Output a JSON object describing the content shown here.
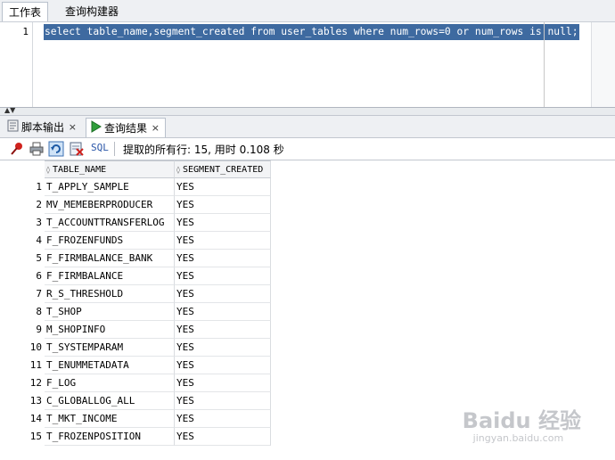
{
  "editor_tabs": [
    "工作表",
    "查询构建器"
  ],
  "editor": {
    "line_number": "1",
    "sql": "select table_name,segment_created from user_tables where num_rows=0 or num_rows is null;"
  },
  "bottom_tabs": {
    "script_output": "脚本输出",
    "query_result": "查询结果",
    "close_glyph": "×"
  },
  "toolbar": {
    "sql_label": "SQL",
    "status": "提取的所有行: 15, 用时 0.108 秒",
    "icons": [
      "pin-icon",
      "print-icon",
      "refresh-icon",
      "clear-icon"
    ]
  },
  "grid": {
    "columns": [
      "TABLE_NAME",
      "SEGMENT_CREATED"
    ],
    "rows": [
      {
        "n": "1",
        "table_name": "T_APPLY_SAMPLE",
        "segment_created": "YES"
      },
      {
        "n": "2",
        "table_name": "MV_MEMEBERPRODUCER",
        "segment_created": "YES"
      },
      {
        "n": "3",
        "table_name": "T_ACCOUNTTRANSFERLOG",
        "segment_created": "YES"
      },
      {
        "n": "4",
        "table_name": "F_FROZENFUNDS",
        "segment_created": "YES"
      },
      {
        "n": "5",
        "table_name": "F_FIRMBALANCE_BANK",
        "segment_created": "YES"
      },
      {
        "n": "6",
        "table_name": "F_FIRMBALANCE",
        "segment_created": "YES"
      },
      {
        "n": "7",
        "table_name": "R_S_THRESHOLD",
        "segment_created": "YES"
      },
      {
        "n": "8",
        "table_name": "T_SHOP",
        "segment_created": "YES"
      },
      {
        "n": "9",
        "table_name": "M_SHOPINFO",
        "segment_created": "YES"
      },
      {
        "n": "10",
        "table_name": "T_SYSTEMPARAM",
        "segment_created": "YES"
      },
      {
        "n": "11",
        "table_name": "T_ENUMMETADATA",
        "segment_created": "YES"
      },
      {
        "n": "12",
        "table_name": "F_LOG",
        "segment_created": "YES"
      },
      {
        "n": "13",
        "table_name": "C_GLOBALLOG_ALL",
        "segment_created": "YES"
      },
      {
        "n": "14",
        "table_name": "T_MKT_INCOME",
        "segment_created": "YES"
      },
      {
        "n": "15",
        "table_name": "T_FROZENPOSITION",
        "segment_created": "YES"
      }
    ]
  },
  "watermark": {
    "main": "Baidu 经验",
    "sub": "jingyan.baidu.com"
  }
}
